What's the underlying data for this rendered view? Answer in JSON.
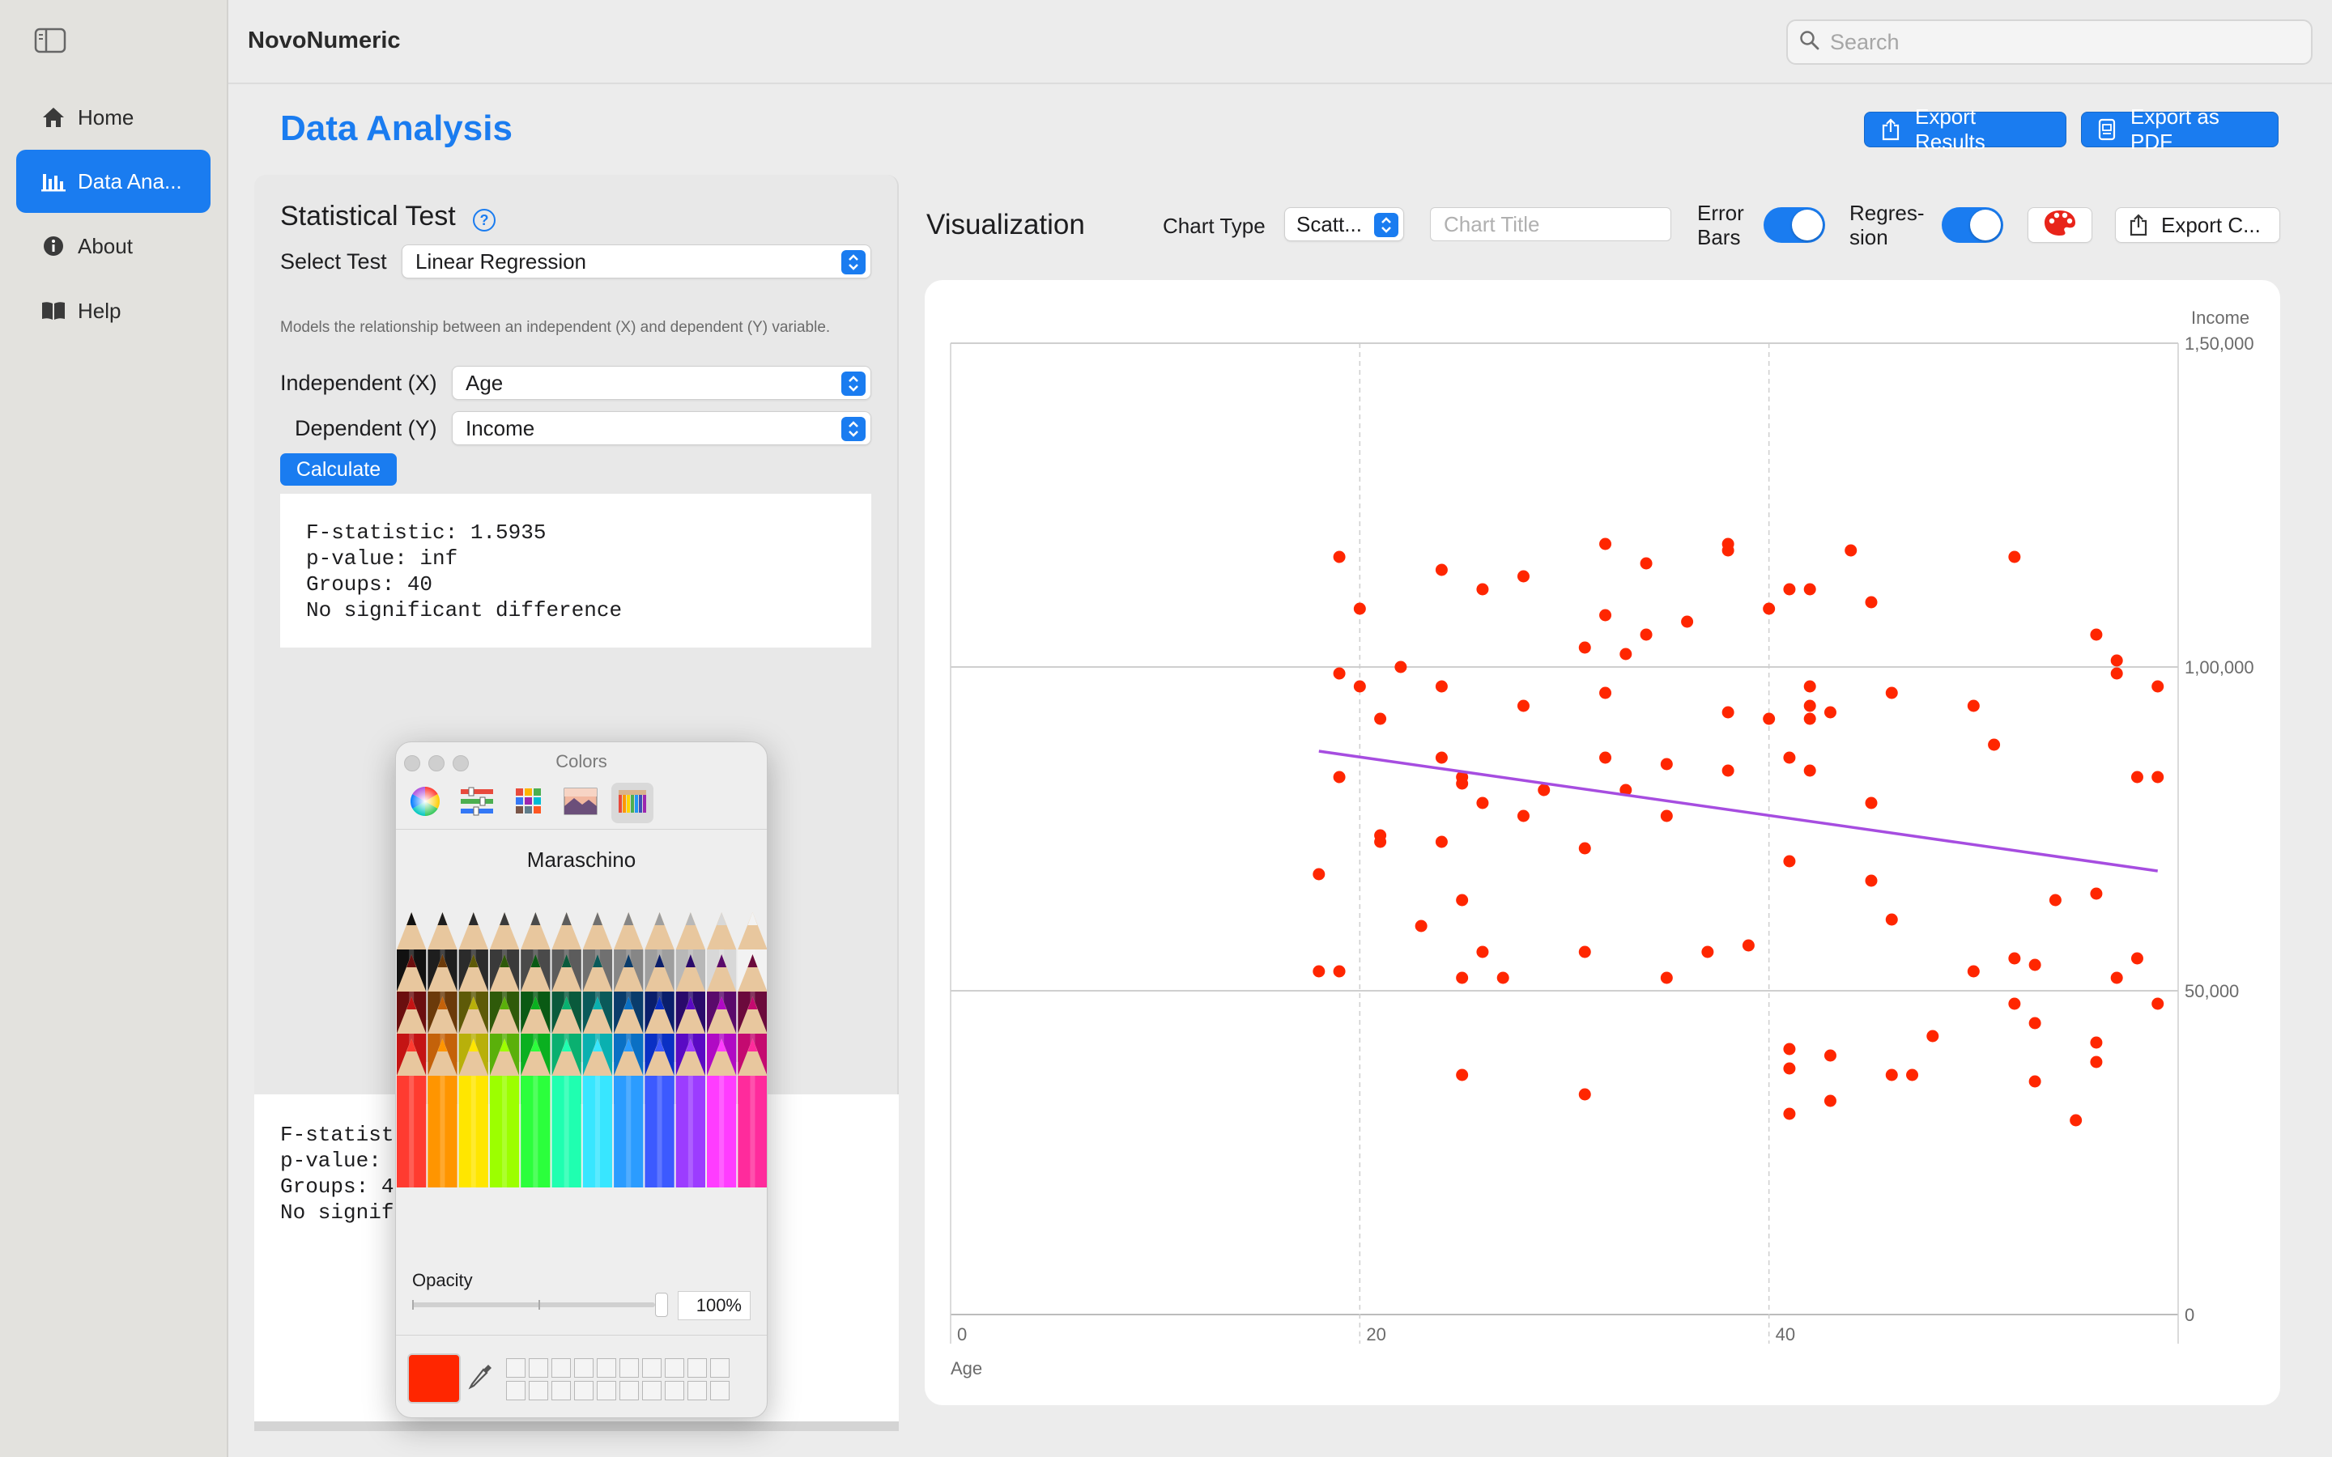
{
  "app": {
    "title": "NovoNumeric",
    "search_placeholder": "Search"
  },
  "sidebar": {
    "items": [
      {
        "label": "Home",
        "icon": "house-icon"
      },
      {
        "label": "Data Ana...",
        "icon": "chart-bar-icon",
        "active": true
      },
      {
        "label": "About",
        "icon": "info-circle-icon"
      },
      {
        "label": "Help",
        "icon": "book-icon"
      }
    ]
  },
  "page": {
    "title": "Data Analysis",
    "export_results": "Export Results",
    "export_pdf": "Export as PDF"
  },
  "test_panel": {
    "title": "Statistical Test",
    "select_test_label": "Select Test",
    "select_test_value": "Linear Regression",
    "description": "Models the relationship between an independent (X) and dependent (Y) variable.",
    "independent_label": "Independent (X)",
    "independent_value": "Age",
    "dependent_label": "Dependent (Y)",
    "dependent_value": "Income",
    "calculate_label": "Calculate",
    "result_text": "F-statistic: 1.5935\np-value: inf\nGroups: 40\nNo significant difference",
    "result_partial": "F-statist\np-value: \nGroups: 4\nNo signif"
  },
  "visualization": {
    "title": "Visualization",
    "chart_type_label": "Chart Type",
    "chart_type_value": "Scatt...",
    "chart_title_placeholder": "Chart Title",
    "error_bars_label": "Error\nBars",
    "error_bars_on": true,
    "regression_label": "Regres-\nsion",
    "regression_on": true,
    "palette_icon": "palette-icon",
    "export_chart_label": "Export C..."
  },
  "chart_data": {
    "type": "scatter",
    "xlabel": "Age",
    "ylabel": "Income",
    "x_ticks": [
      "0",
      "20",
      "40"
    ],
    "y_ticks": [
      "0",
      "50,000",
      "1,00,000",
      "1,50,000"
    ],
    "xlim": [
      0,
      60
    ],
    "ylim": [
      0,
      150000
    ],
    "grid": true,
    "point_color": "#ff2600",
    "regression_color": "#a64de0",
    "regression": {
      "x": [
        18,
        59
      ],
      "y": [
        87000,
        68500
      ]
    },
    "points": [
      [
        18,
        68000
      ],
      [
        18,
        53000
      ],
      [
        19,
        117000
      ],
      [
        19,
        99000
      ],
      [
        19,
        83000
      ],
      [
        19,
        53000
      ],
      [
        20,
        109000
      ],
      [
        20,
        97000
      ],
      [
        21,
        92000
      ],
      [
        21,
        74000
      ],
      [
        21,
        73000
      ],
      [
        22,
        100000
      ],
      [
        23,
        60000
      ],
      [
        24,
        115000
      ],
      [
        24,
        97000
      ],
      [
        24,
        86000
      ],
      [
        24,
        73000
      ],
      [
        25,
        83000
      ],
      [
        25,
        82000
      ],
      [
        25,
        64000
      ],
      [
        25,
        52000
      ],
      [
        25,
        37000
      ],
      [
        26,
        112000
      ],
      [
        26,
        79000
      ],
      [
        26,
        56000
      ],
      [
        27,
        52000
      ],
      [
        28,
        114000
      ],
      [
        28,
        94000
      ],
      [
        28,
        77000
      ],
      [
        29,
        81000
      ],
      [
        31,
        103000
      ],
      [
        31,
        72000
      ],
      [
        31,
        56000
      ],
      [
        31,
        34000
      ],
      [
        32,
        119000
      ],
      [
        32,
        108000
      ],
      [
        32,
        96000
      ],
      [
        32,
        86000
      ],
      [
        33,
        81000
      ],
      [
        33,
        102000
      ],
      [
        34,
        116000
      ],
      [
        34,
        105000
      ],
      [
        35,
        85000
      ],
      [
        35,
        77000
      ],
      [
        35,
        52000
      ],
      [
        36,
        107000
      ],
      [
        37,
        56000
      ],
      [
        38,
        119000
      ],
      [
        38,
        118000
      ],
      [
        38,
        93000
      ],
      [
        38,
        84000
      ],
      [
        39,
        57000
      ],
      [
        40,
        109000
      ],
      [
        40,
        92000
      ],
      [
        41,
        112000
      ],
      [
        41,
        86000
      ],
      [
        41,
        70000
      ],
      [
        41,
        41000
      ],
      [
        41,
        38000
      ],
      [
        41,
        31000
      ],
      [
        42,
        112000
      ],
      [
        42,
        97000
      ],
      [
        42,
        94000
      ],
      [
        42,
        84000
      ],
      [
        42,
        92000
      ],
      [
        43,
        93000
      ],
      [
        43,
        40000
      ],
      [
        43,
        33000
      ],
      [
        44,
        118000
      ],
      [
        45,
        110000
      ],
      [
        45,
        79000
      ],
      [
        45,
        67000
      ],
      [
        46,
        61000
      ],
      [
        46,
        96000
      ],
      [
        46,
        37000
      ],
      [
        47,
        37000
      ],
      [
        48,
        43000
      ],
      [
        50,
        53000
      ],
      [
        50,
        94000
      ],
      [
        51,
        88000
      ],
      [
        52,
        117000
      ],
      [
        52,
        55000
      ],
      [
        52,
        48000
      ],
      [
        53,
        54000
      ],
      [
        53,
        45000
      ],
      [
        53,
        36000
      ],
      [
        54,
        64000
      ],
      [
        55,
        30000
      ],
      [
        56,
        105000
      ],
      [
        56,
        65000
      ],
      [
        56,
        42000
      ],
      [
        56,
        39000
      ],
      [
        57,
        101000
      ],
      [
        57,
        99000
      ],
      [
        57,
        52000
      ],
      [
        58,
        83000
      ],
      [
        58,
        55000
      ],
      [
        59,
        97000
      ],
      [
        59,
        83000
      ],
      [
        59,
        48000
      ]
    ]
  },
  "color_panel": {
    "title": "Colors",
    "color_name": "Maraschino",
    "opacity_label": "Opacity",
    "opacity_value": "100%",
    "opacity": 1.0,
    "selected_color": "#ff2600"
  }
}
